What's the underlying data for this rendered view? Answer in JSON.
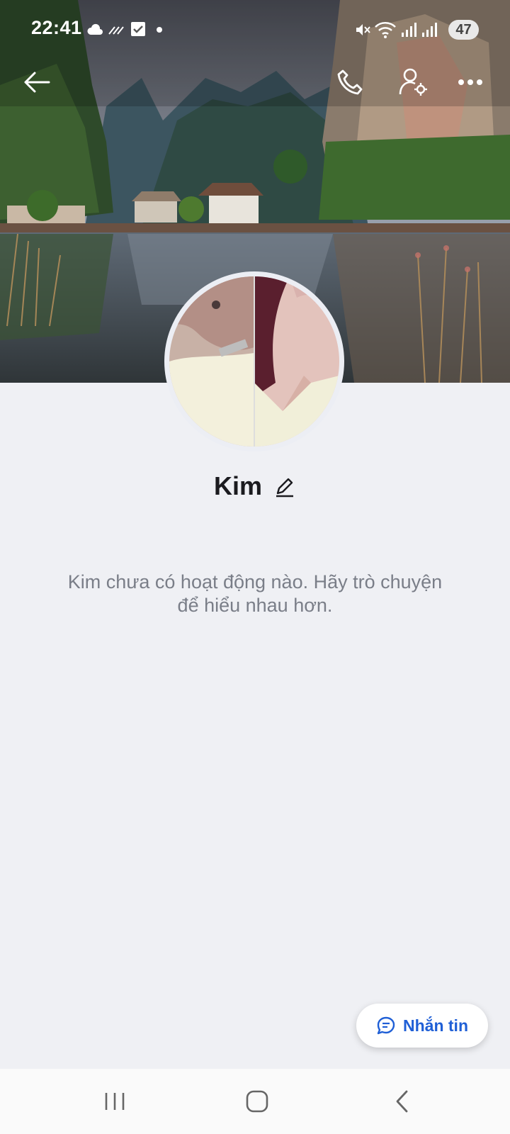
{
  "status_bar": {
    "time": "22:41",
    "battery": "47",
    "icons": [
      "cloud-icon",
      "haze-icon",
      "checkbox-icon",
      "dot-icon",
      "mute-icon",
      "wifi-icon",
      "signal-icon",
      "signal-icon"
    ]
  },
  "header": {
    "back_icon": "arrow-left-icon",
    "call_icon": "phone-icon",
    "settings_icon": "user-settings-icon",
    "more_icon": "more-horizontal-icon"
  },
  "profile": {
    "name": "Kim",
    "edit_icon": "pencil-icon",
    "empty_message": "Kim chưa có hoạt động nào. Hãy trò chuyện để hiểu nhau hơn."
  },
  "message_button": {
    "label": "Nhắn tin",
    "icon": "chat-bubble-icon",
    "color": "#1f5fd6"
  },
  "nav_bar": {
    "icons": [
      "recent-apps-icon",
      "home-icon",
      "back-icon"
    ]
  }
}
